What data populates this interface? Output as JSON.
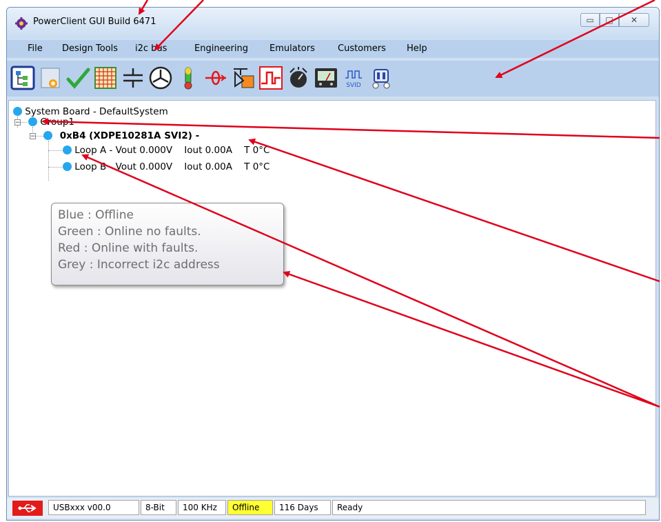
{
  "window": {
    "title": "PowerClient GUI Build 6471"
  },
  "menu": [
    "File",
    "Design Tools",
    "i2c bus",
    "Engineering",
    "Emulators",
    "Customers",
    "Help"
  ],
  "toolbar": {
    "icons": [
      "system-tree-icon",
      "new-design-icon",
      "checkmark-icon",
      "grid-table-icon",
      "capacitor-icon",
      "phase-diagram-icon",
      "thermometer-icon",
      "current-probe-icon",
      "component-icon",
      "waveform-icon",
      "dial-knob-icon",
      "meter-gauge-icon",
      "svid-icon",
      "robot-icon"
    ],
    "svid_label": "SVID"
  },
  "tree": {
    "root": "System Board - DefaultSystem",
    "group": "Group1",
    "device": "0xB4 (XDPE10281A SVI2) -",
    "loops": [
      "Loop A - Vout 0.000V    Iout 0.00A    T 0°C",
      "Loop B - Vout 0.000V    Iout 0.00A    T 0°C"
    ]
  },
  "tooltip": {
    "lines": [
      "Blue : Offline",
      "Green : Online no faults.",
      "Red : Online with faults.",
      "Grey : Incorrect i2c address"
    ]
  },
  "status": {
    "usb": "USBxxx v00.0",
    "bits": "8-Bit",
    "speed": "100 KHz",
    "state": "Offline",
    "days": "116 Days",
    "message": "Ready"
  },
  "colors": {
    "node_offline": "#27a6ee",
    "annotation_arrow": "#e0001b",
    "offline_status": "#ffff33"
  }
}
